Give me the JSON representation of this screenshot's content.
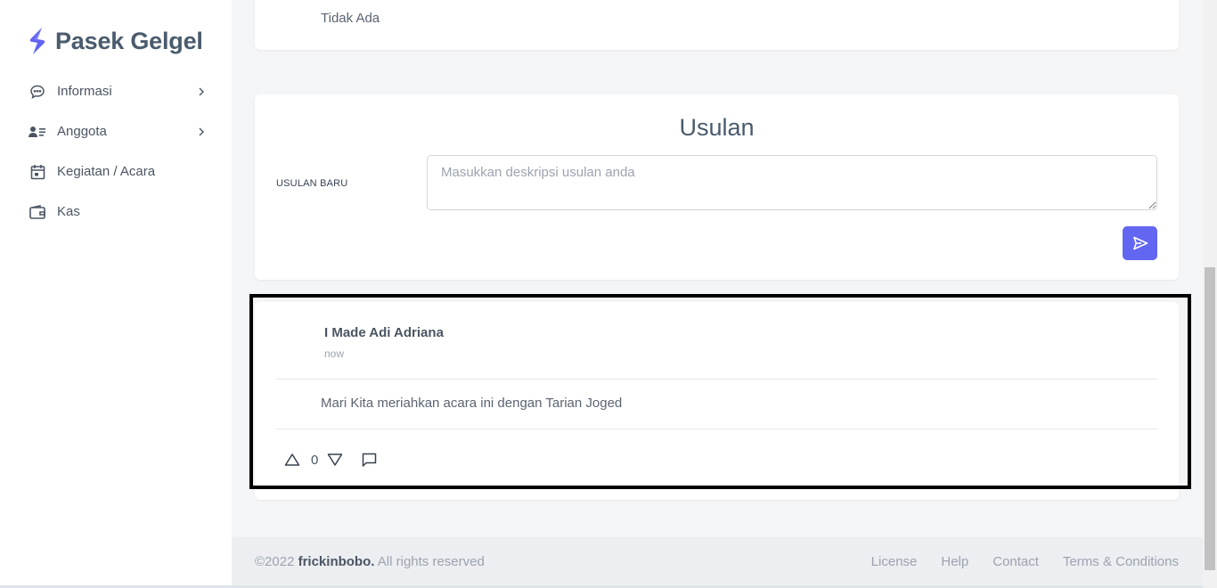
{
  "brand": {
    "name": "Pasek Gelgel",
    "accent": "#6366f1"
  },
  "sidebar": {
    "items": [
      {
        "label": "Informasi",
        "icon": "chat-bubble-icon",
        "has_submenu": true
      },
      {
        "label": "Anggota",
        "icon": "users-list-icon",
        "has_submenu": true
      },
      {
        "label": "Kegiatan / Acara",
        "icon": "calendar-icon",
        "has_submenu": false
      },
      {
        "label": "Kas",
        "icon": "wallet-icon",
        "has_submenu": false
      }
    ]
  },
  "top_card": {
    "text": "Tidak Ada"
  },
  "usulan": {
    "title": "Usulan",
    "label": "USULAN BARU",
    "placeholder": "Masukkan deskripsi usulan anda",
    "value": "",
    "send_icon": "send-icon"
  },
  "post": {
    "author": "I Made Adi Adriana",
    "time": "now",
    "body": "Mari Kita meriahkan acara ini dengan Tarian Joged",
    "votes": "0"
  },
  "footer": {
    "year": "©2022",
    "company": "frickinbobo.",
    "rights": "All rights reserved",
    "links": [
      "License",
      "Help",
      "Contact",
      "Terms & Conditions"
    ]
  }
}
